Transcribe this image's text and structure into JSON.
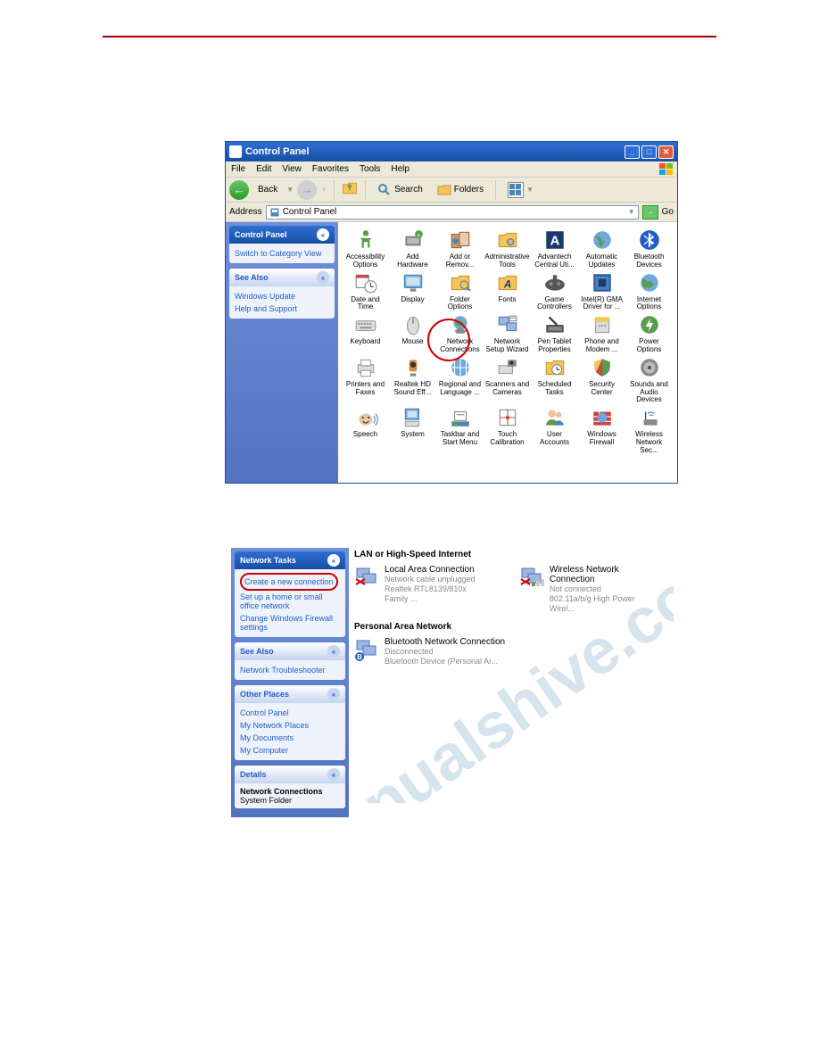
{
  "win1": {
    "title": "Control Panel",
    "menu": [
      "File",
      "Edit",
      "View",
      "Favorites",
      "Tools",
      "Help"
    ],
    "toolbar": {
      "back": "Back",
      "search": "Search",
      "folders": "Folders"
    },
    "address_label": "Address",
    "address_value": "Control Panel",
    "go": "Go",
    "sidebar": {
      "panel1_title": "Control Panel",
      "panel1_link": "Switch to Category View",
      "panel2_title": "See Also",
      "panel2_links": [
        "Windows Update",
        "Help and Support"
      ]
    },
    "icons": [
      [
        "Accessibility Options",
        "Add Hardware",
        "Add or Remov...",
        "Administrative Tools",
        "Advantech Central Uti...",
        "Automatic Updates",
        "Bluetooth Devices"
      ],
      [
        "Date and Time",
        "Display",
        "Folder Options",
        "Fonts",
        "Game Controllers",
        "Intel(R) GMA Driver for ...",
        "Internet Options"
      ],
      [
        "Keyboard",
        "Mouse",
        "Network Connections",
        "Network Setup Wizard",
        "Pen Tablet Properties",
        "Phone and Modem ...",
        "Power Options"
      ],
      [
        "Printers and Faxes",
        "Realtek HD Sound Eff...",
        "Regional and Language ...",
        "Scanners and Cameras",
        "Scheduled Tasks",
        "Security Center",
        "Sounds and Audio Devices"
      ],
      [
        "Speech",
        "System",
        "Taskbar and Start Menu",
        "Touch Calibration",
        "User Accounts",
        "Windows Firewall",
        "Wireless Network Sec..."
      ]
    ]
  },
  "win2": {
    "sidebar": {
      "tasks_title": "Network Tasks",
      "tasks": [
        "Create a new connection",
        "Set up a home or small office network",
        "Change Windows Firewall settings"
      ],
      "seealso_title": "See Also",
      "seealso_links": [
        "Network Troubleshooter"
      ],
      "other_title": "Other Places",
      "other_links": [
        "Control Panel",
        "My Network Places",
        "My Documents",
        "My Computer"
      ],
      "details_title": "Details",
      "details_name": "Network Connections",
      "details_type": "System Folder"
    },
    "sections": {
      "lan_title": "LAN or High-Speed Internet",
      "lan_items": [
        {
          "name": "Local Area Connection",
          "status": "Network cable unplugged",
          "device": "Realtek RTL8139/810x Family ..."
        },
        {
          "name": "Wireless Network Connection",
          "status": "Not connected",
          "device": "802.11a/b/g High Power Wirel..."
        }
      ],
      "pan_title": "Personal Area Network",
      "pan_items": [
        {
          "name": "Bluetooth Network Connection",
          "status": "Disconnected",
          "device": "Bluetooth Device (Personal Ar..."
        }
      ]
    }
  }
}
